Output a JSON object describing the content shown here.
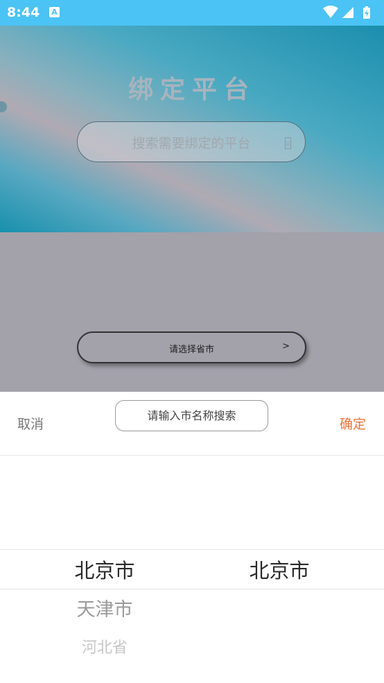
{
  "status_bar": {
    "time": "8:44",
    "notification_icon": "A",
    "icons": [
      "wifi-icon",
      "signal-icon",
      "battery-icon"
    ]
  },
  "background": {
    "title": "绑定平台",
    "search_placeholder": "搜索需要绑定的平台",
    "select_label": "请选择省市",
    "select_arrow": ">"
  },
  "picker": {
    "cancel_label": "取消",
    "confirm_label": "确定",
    "search_placeholder": "请输入市名称搜索",
    "province_column": [
      "北京市",
      "天津市",
      "河北省"
    ],
    "city_column": [
      "北京市"
    ],
    "selected_province": "北京市",
    "selected_city": "北京市"
  },
  "colors": {
    "status_bar": "#4bc3f5",
    "confirm": "#f0743a",
    "overlay": "#a3a1aa"
  }
}
